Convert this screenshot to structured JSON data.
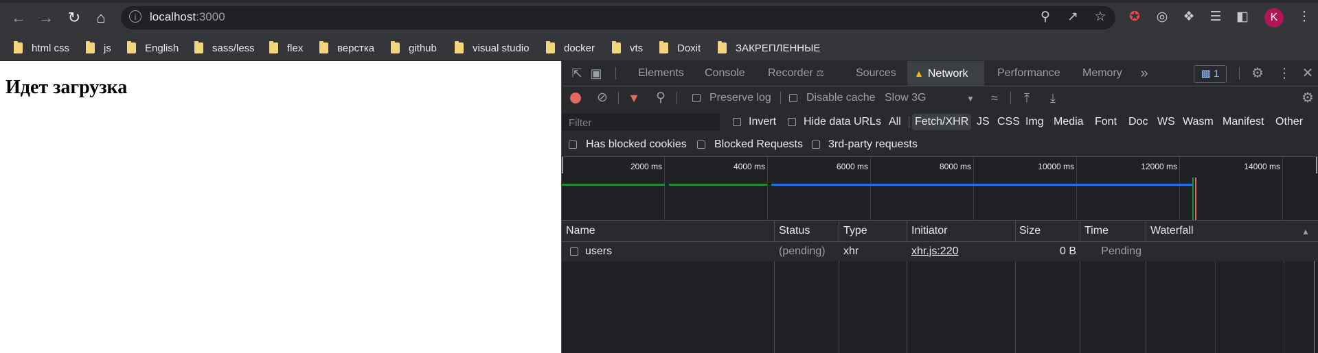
{
  "browser": {
    "url_host": "localhost",
    "url_port": ":3000",
    "profile_initial": "K",
    "accent": "#b1155a"
  },
  "bookmarks": [
    "html css",
    "js",
    "English",
    "sass/less",
    "flex",
    "верстка",
    "github",
    "visual studio",
    "docker",
    "vts",
    "Doxit",
    "ЗАКРЕПЛЕННЫЕ"
  ],
  "page": {
    "heading": "Идет загрузка"
  },
  "devtools": {
    "tabs": [
      "Elements",
      "Console",
      "Recorder",
      "Sources",
      "Network",
      "Performance",
      "Memory"
    ],
    "active_tab": "Network",
    "message_count": "1",
    "toolbar": {
      "preserve_log": "Preserve log",
      "disable_cache": "Disable cache",
      "throttling": "Slow 3G"
    },
    "filter": {
      "placeholder": "Filter",
      "invert": "Invert",
      "hide_data_urls": "Hide data URLs",
      "types": [
        "All",
        "Fetch/XHR",
        "JS",
        "CSS",
        "Img",
        "Media",
        "Font",
        "Doc",
        "WS",
        "Wasm",
        "Manifest",
        "Other"
      ],
      "selected_type": "Fetch/XHR",
      "has_blocked_cookies": "Has blocked cookies",
      "blocked_requests": "Blocked Requests",
      "third_party": "3rd-party requests"
    },
    "timeline_ticks": [
      "2000 ms",
      "4000 ms",
      "6000 ms",
      "8000 ms",
      "10000 ms",
      "12000 ms",
      "14000 ms"
    ],
    "columns": [
      "Name",
      "Status",
      "Type",
      "Initiator",
      "Size",
      "Time",
      "Waterfall"
    ],
    "rows": [
      {
        "name": "users",
        "status": "(pending)",
        "type": "xhr",
        "initiator": "xhr.js:220",
        "size": "0 B",
        "time": "Pending"
      }
    ]
  }
}
